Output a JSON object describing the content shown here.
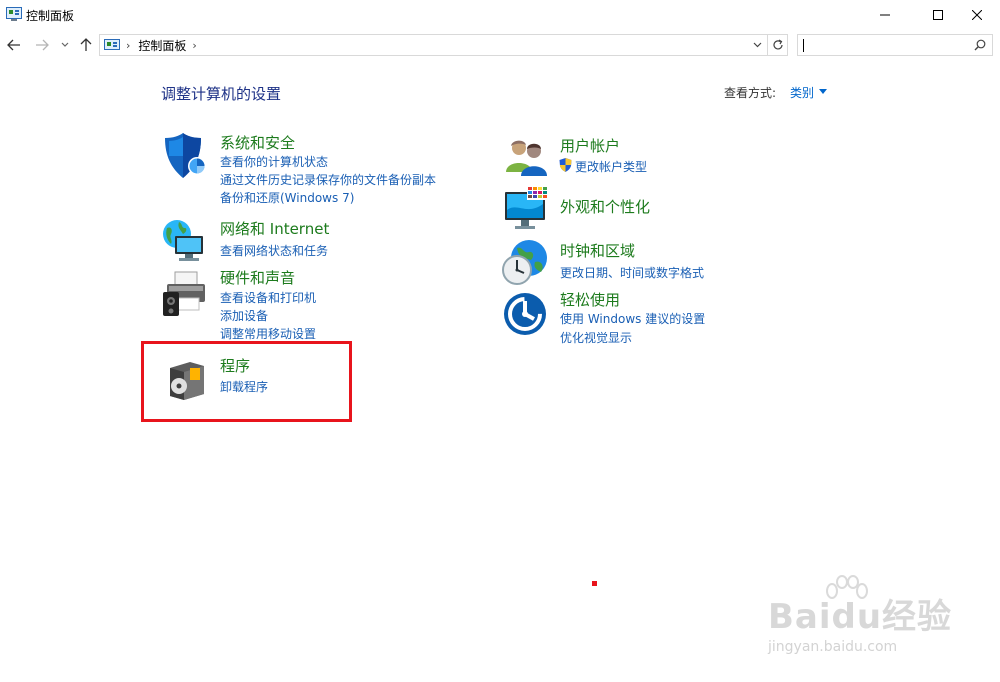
{
  "window": {
    "title": "控制面板"
  },
  "address": {
    "path": "控制面板",
    "sep": "›"
  },
  "search": {
    "placeholder": ""
  },
  "content": {
    "heading": "调整计算机的设置",
    "view_by_label": "查看方式:",
    "view_by_value": "类别"
  },
  "categories": {
    "security": {
      "title": "系统和安全",
      "links": [
        "查看你的计算机状态",
        "通过文件历史记录保存你的文件备份副本",
        "备份和还原(Windows 7)"
      ]
    },
    "network": {
      "title": "网络和 Internet",
      "links": [
        "查看网络状态和任务"
      ]
    },
    "hardware": {
      "title": "硬件和声音",
      "links": [
        "查看设备和打印机",
        "添加设备",
        "调整常用移动设置"
      ]
    },
    "programs": {
      "title": "程序",
      "links": [
        "卸载程序"
      ]
    },
    "users": {
      "title": "用户帐户",
      "links": [
        "更改帐户类型"
      ]
    },
    "appearance": {
      "title": "外观和个性化",
      "links": []
    },
    "clock": {
      "title": "时钟和区域",
      "links": [
        "更改日期、时间或数字格式"
      ]
    },
    "ease": {
      "title": "轻松使用",
      "links": [
        "使用 Windows 建议的设置",
        "优化视觉显示"
      ]
    }
  },
  "watermark": {
    "brand": "Baidu经验",
    "url": "jingyan.baidu.com"
  },
  "colors": {
    "title_green": "#1d7b1d",
    "link_blue": "#1a5fb4",
    "heading_navy": "#1e3287",
    "highlight_red": "#e8141c"
  }
}
